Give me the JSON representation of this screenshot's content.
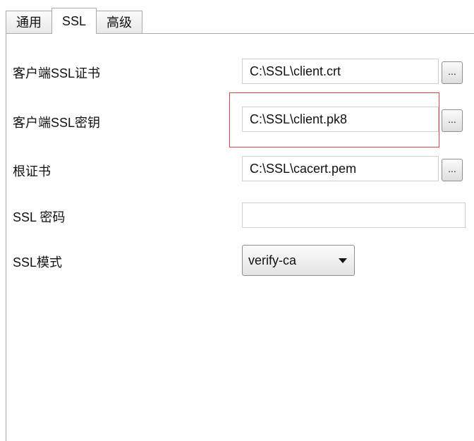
{
  "tabs": [
    {
      "label": "通用"
    },
    {
      "label": "SSL",
      "active": true
    },
    {
      "label": "高级"
    }
  ],
  "form": {
    "client_cert": {
      "label": "客户端SSL证书",
      "value": "C:\\SSL\\client.crt",
      "browse_label": "..."
    },
    "client_key": {
      "label": "客户端SSL密钥",
      "value": "C:\\SSL\\client.pk8",
      "browse_label": "..."
    },
    "root_cert": {
      "label": "根证书",
      "value": "C:\\SSL\\cacert.pem",
      "browse_label": "..."
    },
    "ssl_password": {
      "label": "SSL 密码",
      "value": ""
    },
    "ssl_mode": {
      "label": "SSL模式",
      "value": "verify-ca"
    }
  },
  "annotation": {
    "color": "#e0414a"
  }
}
